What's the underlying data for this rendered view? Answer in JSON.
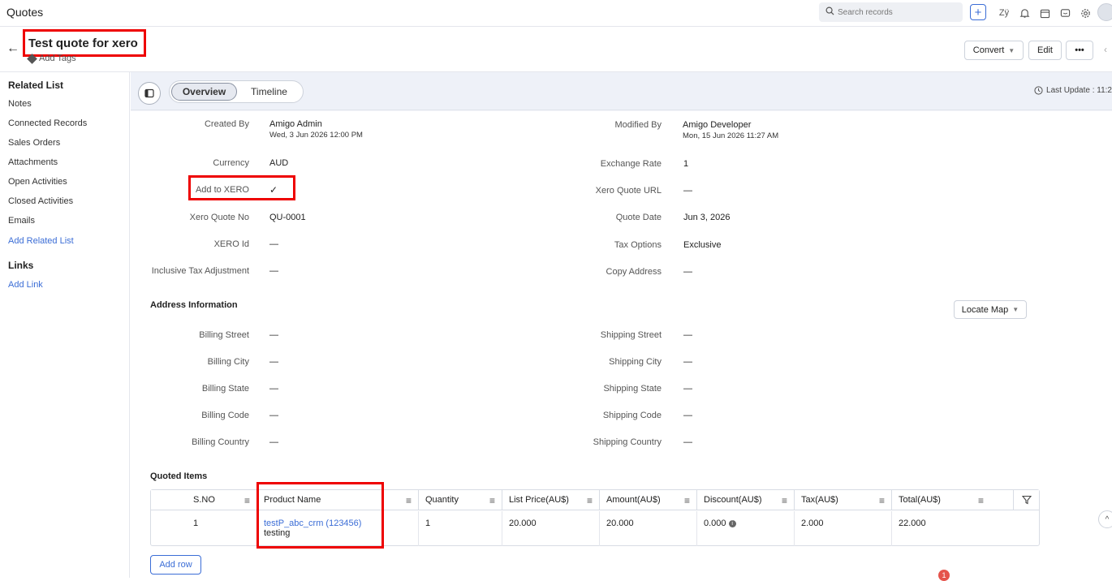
{
  "app": {
    "title": "Quotes"
  },
  "search": {
    "placeholder": "Search records"
  },
  "record": {
    "title": "Test quote for xero",
    "add_tags": "Add Tags"
  },
  "actions": {
    "convert": "Convert",
    "edit": "Edit",
    "more": "•••"
  },
  "sidebar": {
    "related_heading": "Related List",
    "items": [
      "Notes",
      "Connected Records",
      "Sales Orders",
      "Attachments",
      "Open Activities",
      "Closed Activities",
      "Emails"
    ],
    "add_related": "Add Related List",
    "links_heading": "Links",
    "add_link": "Add Link"
  },
  "tabs": {
    "overview": "Overview",
    "timeline": "Timeline"
  },
  "last_update": "Last Update : 11:2",
  "fields": {
    "created_by_label": "Created By",
    "created_by": "Amigo Admin",
    "created_on": "Wed, 3 Jun 2026 12:00 PM",
    "modified_by_label": "Modified By",
    "modified_by": "Amigo Developer",
    "modified_on": "Mon, 15 Jun 2026 11:27 AM",
    "currency_label": "Currency",
    "currency": "AUD",
    "exchange_rate_label": "Exchange Rate",
    "exchange_rate": "1",
    "add_to_xero_label": "Add to XERO",
    "add_to_xero": "✓",
    "xero_quote_url_label": "Xero Quote URL",
    "xero_quote_url": "—",
    "xero_quote_no_label": "Xero Quote No",
    "xero_quote_no": "QU-0001",
    "quote_date_label": "Quote Date",
    "quote_date": "Jun 3, 2026",
    "xero_id_label": "XERO Id",
    "xero_id": "—",
    "tax_options_label": "Tax Options",
    "tax_options": "Exclusive",
    "inclusive_tax_label": "Inclusive Tax Adjustment",
    "inclusive_tax": "—",
    "copy_address_label": "Copy Address",
    "copy_address": "—"
  },
  "address": {
    "title": "Address Information",
    "locate_map": "Locate Map",
    "billing_street_label": "Billing Street",
    "billing_street": "—",
    "shipping_street_label": "Shipping Street",
    "shipping_street": "—",
    "billing_city_label": "Billing City",
    "billing_city": "—",
    "shipping_city_label": "Shipping City",
    "shipping_city": "—",
    "billing_state_label": "Billing State",
    "billing_state": "—",
    "shipping_state_label": "Shipping State",
    "shipping_state": "—",
    "billing_code_label": "Billing Code",
    "billing_code": "—",
    "shipping_code_label": "Shipping Code",
    "shipping_code": "—",
    "billing_country_label": "Billing Country",
    "billing_country": "—",
    "shipping_country_label": "Shipping Country",
    "shipping_country": "—"
  },
  "items": {
    "title": "Quoted Items",
    "columns": [
      "S.NO",
      "Product Name",
      "Quantity",
      "List Price(AU$)",
      "Amount(AU$)",
      "Discount(AU$)",
      "Tax(AU$)",
      "Total(AU$)"
    ],
    "rows": [
      {
        "sno": "1",
        "product": "testP_abc_crm (123456)",
        "description": "testing",
        "quantity": "1",
        "list_price": "20.000",
        "amount": "20.000",
        "discount": "0.000",
        "tax": "2.000",
        "total": "22.000"
      }
    ],
    "add_row": "Add row"
  },
  "notification_count": "1"
}
